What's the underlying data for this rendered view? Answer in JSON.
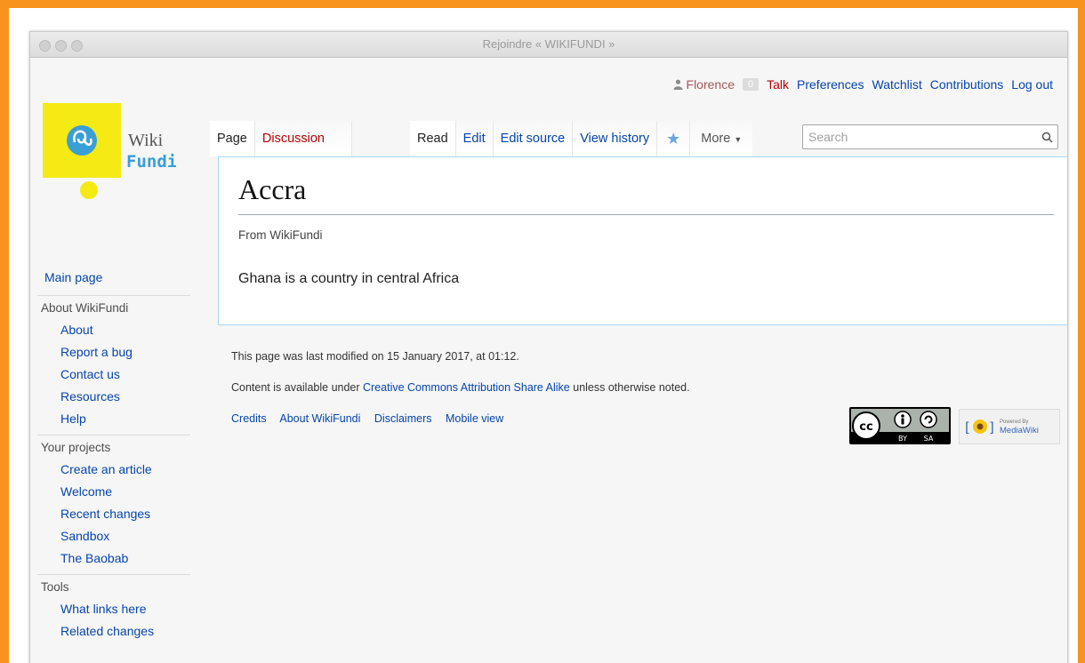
{
  "window": {
    "title": "Rejoindre « WIKIFUNDI »"
  },
  "personal": {
    "user": "Florence",
    "notifications": "0",
    "talk": "Talk",
    "preferences": "Preferences",
    "watchlist": "Watchlist",
    "contributions": "Contributions",
    "logout": "Log out"
  },
  "logo": {
    "line1": "Wiki",
    "line2": "Fundi"
  },
  "tabs": {
    "page": "Page",
    "discussion": "Discussion",
    "read": "Read",
    "edit": "Edit",
    "edit_source": "Edit source",
    "view_history": "View history",
    "more": "More"
  },
  "search": {
    "placeholder": "Search"
  },
  "article": {
    "title": "Accra",
    "subtitle": "From WikiFundi",
    "body": "Ghana is a country in central Africa"
  },
  "sidebar": {
    "main_page": "Main page",
    "about_heading": "About WikiFundi",
    "about_links": [
      "About",
      "Report a bug",
      "Contact us",
      "Resources",
      "Help"
    ],
    "projects_heading": "Your projects",
    "project_links": [
      "Create an article",
      "Welcome",
      "Recent changes",
      "Sandbox",
      "The Baobab"
    ],
    "tools_heading": "Tools",
    "tool_links": [
      "What links here",
      "Related changes"
    ]
  },
  "footer": {
    "last_modified": "This page was last modified on 15 January 2017, at 01:12.",
    "license_prefix": "Content is available under ",
    "license_link": "Creative Commons Attribution Share Alike",
    "license_suffix": " unless otherwise noted.",
    "places": [
      "Credits",
      "About WikiFundi",
      "Disclaimers",
      "Mobile view"
    ],
    "cc_by": "BY",
    "cc_sa": "SA",
    "powered_by": "Powered By",
    "mediawiki": "MediaWiki"
  },
  "colors": {
    "frame": "#f8931d",
    "link": "#0645ad",
    "new_link": "#ba0000",
    "logo_yellow": "#f5ea14",
    "logo_blue": "#3a9fd6"
  }
}
